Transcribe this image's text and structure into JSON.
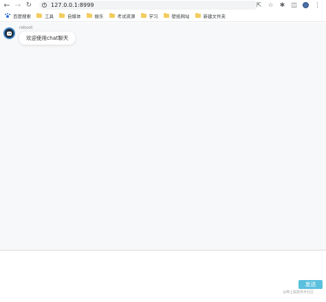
{
  "browser": {
    "url": "127.0.0.1:8999"
  },
  "bookmarks": [
    {
      "label": "百度搜索",
      "icon": "paw-icon"
    },
    {
      "label": "工具",
      "icon": "folder-icon"
    },
    {
      "label": "自媒体",
      "icon": "folder-icon"
    },
    {
      "label": "娱乐",
      "icon": "folder-icon"
    },
    {
      "label": "考试资源",
      "icon": "folder-icon"
    },
    {
      "label": "学习",
      "icon": "folder-icon"
    },
    {
      "label": "壁纸网站",
      "icon": "folder-icon"
    },
    {
      "label": "新建文件夹",
      "icon": "folder-icon"
    }
  ],
  "chat": {
    "messages": [
      {
        "sender": "reboot",
        "text": "欢迎使用chat聊天"
      }
    ]
  },
  "composer": {
    "send_label": "发送"
  },
  "watermark": "@稀土掘金技术社区",
  "colors": {
    "send_button": "#5bc0de",
    "chat_background": "#f7f8fa",
    "folder": "#f2cc5f"
  }
}
